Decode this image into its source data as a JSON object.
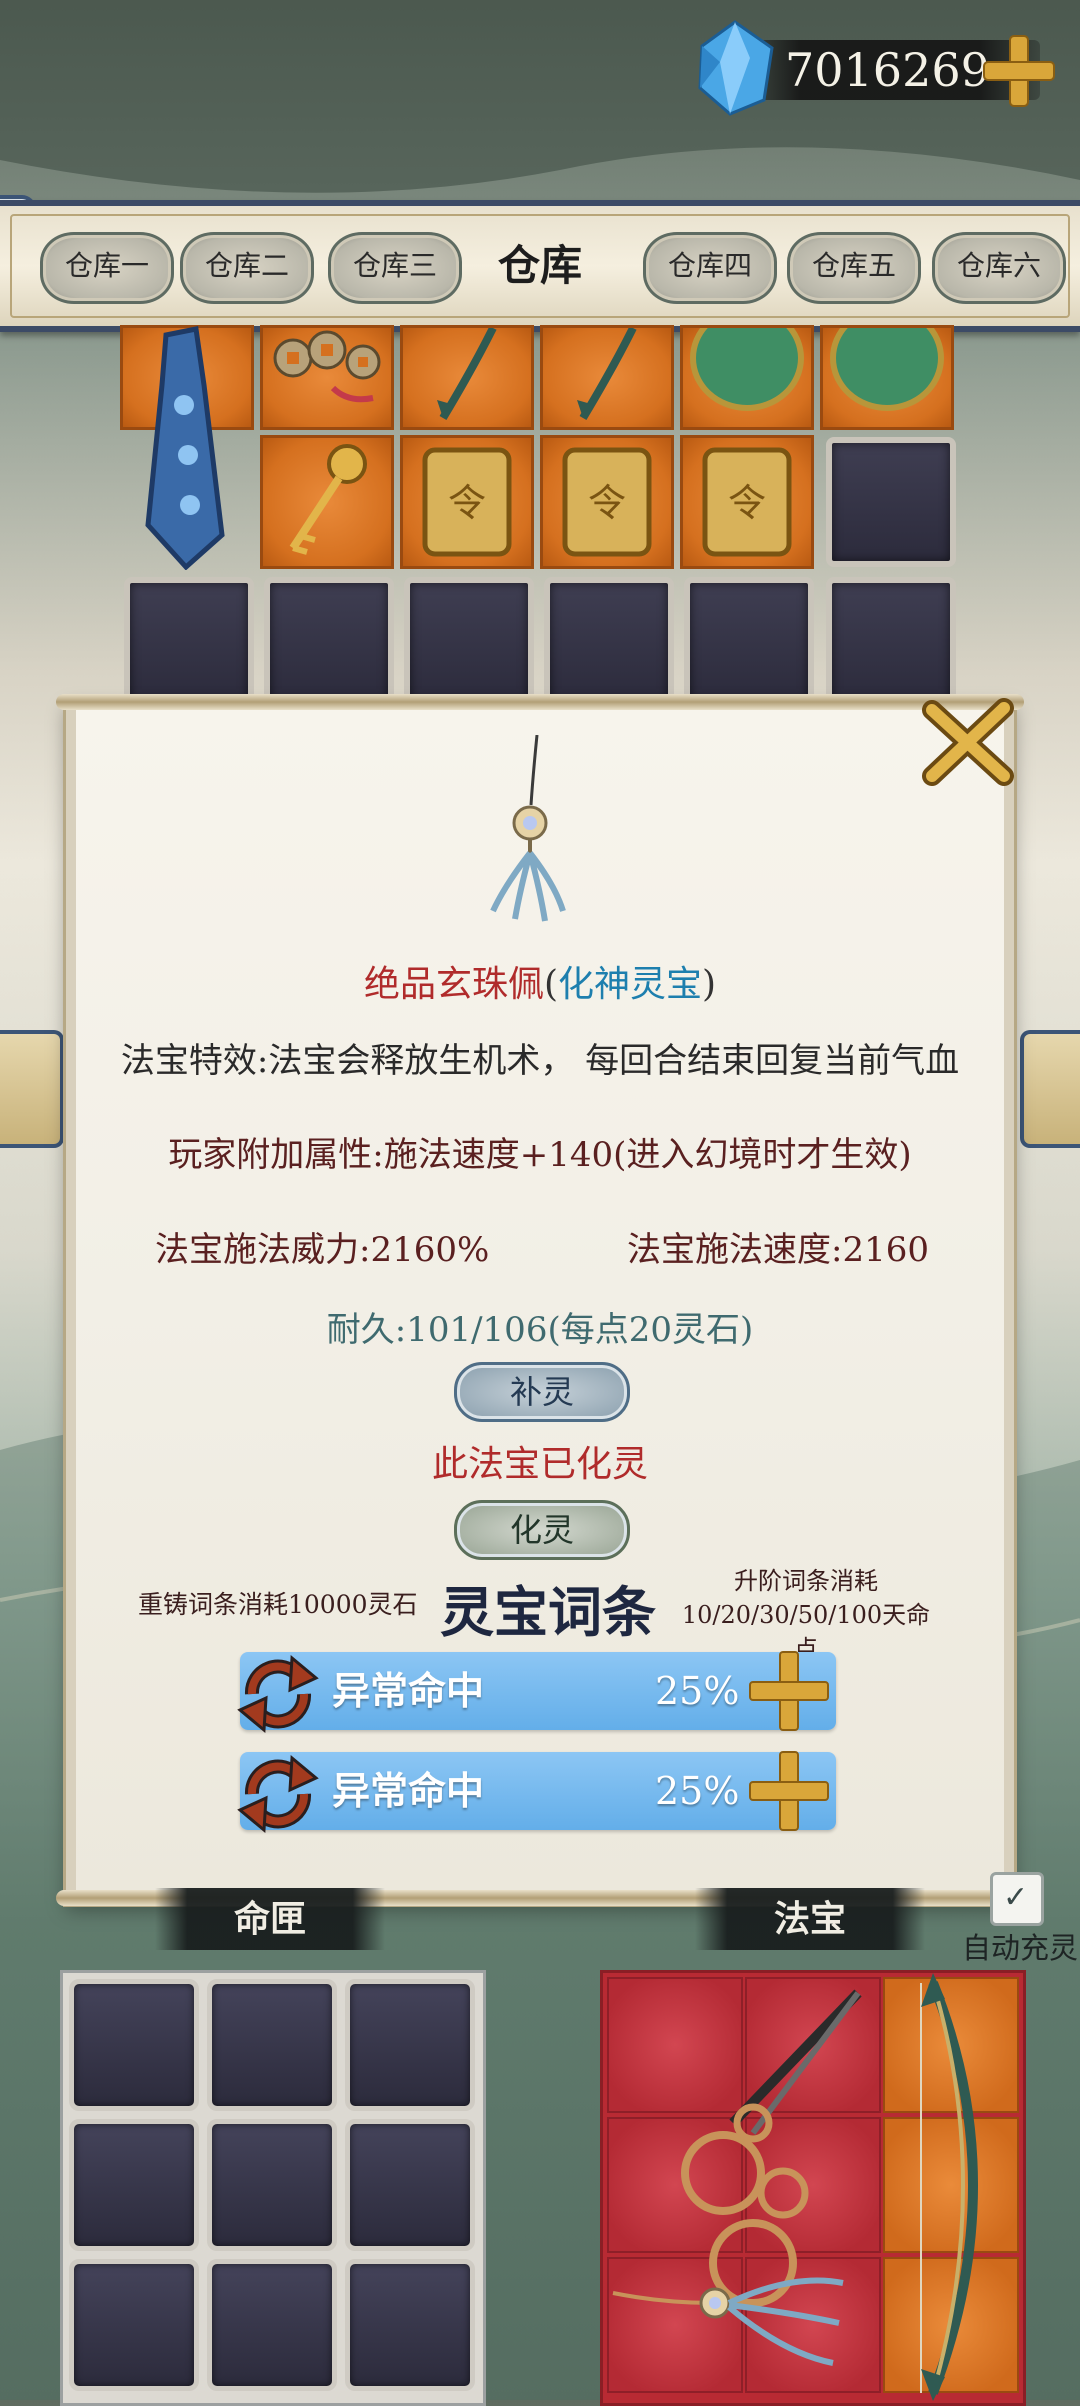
{
  "currency": {
    "value": "7016269",
    "gem_icon": "blue-crystal-icon",
    "add_icon": "gold-plus-icon"
  },
  "warehouse": {
    "title": "仓库",
    "tabs": [
      "仓库一",
      "仓库二",
      "仓库三",
      "仓库四",
      "仓库五",
      "仓库六"
    ]
  },
  "inventory": {
    "items": [
      "blue-jade-tablet",
      "coin-string-charm",
      "jade-tassel-pendant",
      "jade-tassel-pendant",
      "green-jade-disc",
      "green-jade-disc",
      "golden-key",
      "gold-command-token",
      "gold-command-token",
      "gold-command-token"
    ]
  },
  "detail": {
    "item_name": "绝品玄珠佩",
    "quality_open": "(",
    "quality": "化神灵宝",
    "quality_close": ")",
    "effect": "法宝特效:法宝会释放生机术， 每回合结束回复当前气血",
    "player_attr": "玩家附加属性:施法速度+140(进入幻境时才生效)",
    "power": "法宝施法威力:2160%",
    "speed": "法宝施法速度:2160",
    "durability": "耐久:101/106(每点20灵石)",
    "refill_button": "补灵",
    "spirit_status": "此法宝已化灵",
    "refine_button": "化灵",
    "reforge_cost": "重铸词条消耗10000灵石",
    "affix_title": "灵宝词条",
    "upgrade_cost_line1": "升阶词条消耗",
    "upgrade_cost_line2": "10/20/30/50/100天命点",
    "affixes": [
      {
        "name": "异常命中",
        "value": "25%"
      },
      {
        "name": "异常命中",
        "value": "25%"
      }
    ]
  },
  "bottom": {
    "left_label": "命匣",
    "right_label": "法宝",
    "auto_refill": "自动充灵",
    "auto_refill_checked": true
  },
  "colors": {
    "accent_red": "#b02b2b",
    "accent_blue": "#1d7fae",
    "affix_blue": "#63aee9",
    "gold": "#d9a63a"
  }
}
